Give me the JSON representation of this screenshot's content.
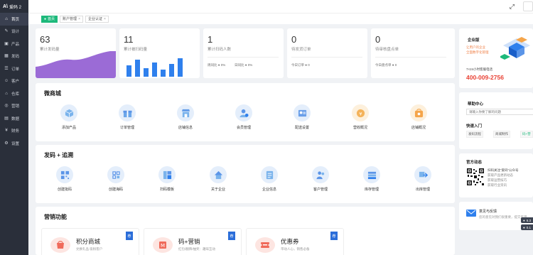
{
  "app": {
    "logo_mark": "A\\",
    "logo_text": "爱码 2"
  },
  "sidebar": {
    "items": [
      {
        "label": "首页",
        "icon": "home-icon"
      },
      {
        "label": "设计",
        "icon": "design-icon"
      },
      {
        "label": "产品",
        "icon": "product-icon"
      },
      {
        "label": "发码",
        "icon": "code-icon"
      },
      {
        "label": "订单",
        "icon": "order-icon"
      },
      {
        "label": "客户",
        "icon": "customer-icon"
      },
      {
        "label": "仓库",
        "icon": "warehouse-icon"
      },
      {
        "label": "营销",
        "icon": "marketing-icon"
      },
      {
        "label": "数据",
        "icon": "data-icon"
      },
      {
        "label": "财务",
        "icon": "finance-icon"
      },
      {
        "label": "设置",
        "icon": "settings-icon"
      }
    ]
  },
  "tabs": [
    {
      "label": "首页",
      "active": true
    },
    {
      "label": "账户管理",
      "active": false
    },
    {
      "label": "企业认证",
      "active": false
    }
  ],
  "stats": [
    {
      "value": "63",
      "label": "累计发码量"
    },
    {
      "value": "11",
      "label": "累计被扫码量"
    },
    {
      "value": "1",
      "label": "累计扫码人数",
      "sub1": "周同比 ● 0%",
      "sub2": "日同比 ● 0%"
    },
    {
      "value": "0",
      "label": "待发货订单",
      "sub1": "今日订单 ● 0"
    },
    {
      "value": "0",
      "label": "待审核盘点单",
      "sub1": "今日盘点单 ● 0"
    }
  ],
  "mall": {
    "title": "微商城",
    "items": [
      "添加产品",
      "订单管理",
      "店铺信息",
      "会员管理",
      "配送设置",
      "营收概况",
      "店铺概况"
    ],
    "colors": [
      "#7ab3ec",
      "#6ba6ea",
      "#5f9ae8",
      "#5b95e8",
      "#6a9fe9",
      "#f4b35a",
      "#f5a54a"
    ]
  },
  "codes": {
    "title": "发码 + 追溯",
    "items": [
      "创建批码",
      "创建海码",
      "扫码模板",
      "关于企业",
      "企业信息",
      "客户管理",
      "库存管理",
      "出库管理"
    ]
  },
  "marketing": {
    "title": "营销功能",
    "cards": [
      {
        "title": "积分商城",
        "desc": "兑换礼品 吸粉客户",
        "badge": "荐"
      },
      {
        "title": "码+营销",
        "desc": "红包/翻牌/抽奖：趣味互动",
        "badge": "荐"
      },
      {
        "title": "优惠券",
        "desc": "带动人心，销售必备",
        "badge": "荐"
      }
    ]
  },
  "enterprise": {
    "title": "企业版",
    "line1": "让用户的企业",
    "line2": "全面数字化管理",
    "service": "7×24小时客服电话",
    "phone": "400-009-2756"
  },
  "help": {
    "title": "帮助中心",
    "search_placeholder": "请输入你要了解的问题",
    "quick_title": "快速入门",
    "quick_links": [
      "发码流程",
      "商城制作",
      "码+营"
    ]
  },
  "official": {
    "title": "官方动态",
    "lines": [
      "扫码关注“爱码”公众号",
      "获取产品更新动态",
      "获取运营技巧",
      "获取行业资讯"
    ]
  },
  "feedback": {
    "title": "意见与反馈",
    "desc": "您的意见对我们很重要，提交反馈"
  },
  "float_tags": [
    "6.3",
    "0.1"
  ]
}
